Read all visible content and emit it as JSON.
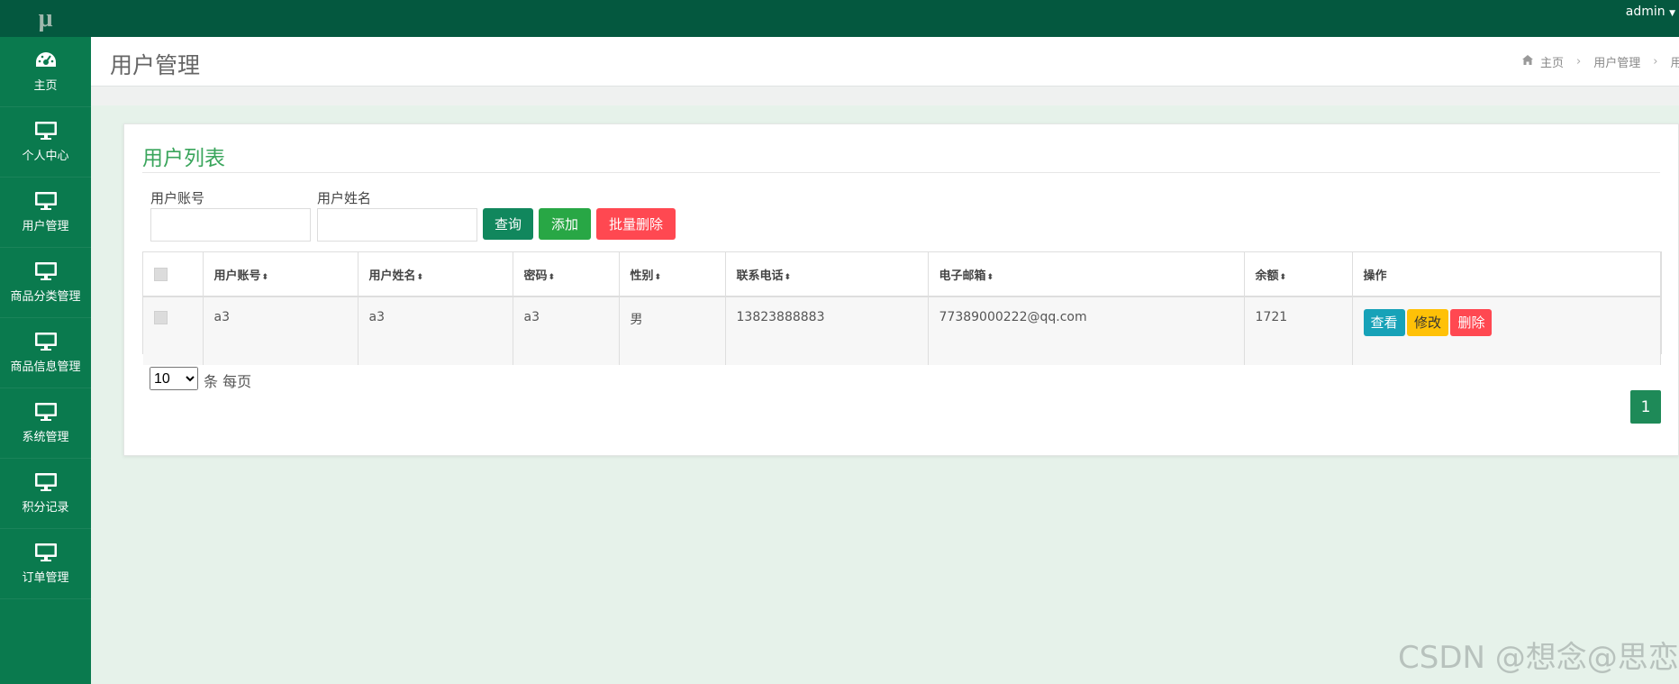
{
  "colors": {
    "sidebar": "#0a7a4e",
    "topbar": "#04583f",
    "accent_green": "#3aa55c",
    "btn_query": "#11875d",
    "btn_add": "#28a745",
    "btn_batch_delete": "#ff4851",
    "btn_view": "#17a2b8",
    "btn_edit": "#ffc107",
    "btn_delete": "#ff4851"
  },
  "logo": "μ",
  "sidebar": {
    "items": [
      {
        "label": "主页",
        "icon": "dashboard-icon"
      },
      {
        "label": "个人中心",
        "icon": "monitor-icon"
      },
      {
        "label": "用户管理",
        "icon": "monitor-icon"
      },
      {
        "label": "商品分类管理",
        "icon": "monitor-icon"
      },
      {
        "label": "商品信息管理",
        "icon": "monitor-icon"
      },
      {
        "label": "系统管理",
        "icon": "monitor-icon"
      },
      {
        "label": "积分记录",
        "icon": "monitor-icon"
      },
      {
        "label": "订单管理",
        "icon": "monitor-icon"
      }
    ]
  },
  "topbar": {
    "user": "admin"
  },
  "header": {
    "title": "用户管理",
    "breadcrumb": [
      "主页",
      "用户管理",
      "用"
    ]
  },
  "card": {
    "title": "用户列表",
    "search": {
      "account_label": "用户账号",
      "name_label": "用户姓名",
      "account_value": "",
      "name_value": ""
    },
    "buttons": {
      "query": "查询",
      "add": "添加",
      "batch_delete": "批量删除"
    }
  },
  "table": {
    "columns": [
      "用户账号",
      "用户姓名",
      "密码",
      "性别",
      "联系电话",
      "电子邮箱",
      "余额",
      "操作"
    ],
    "rows": [
      {
        "account": "a3",
        "name": "a3",
        "password": "a3",
        "gender": "男",
        "phone": "13823888883",
        "email": "77389000222@qq.com",
        "balance": "1721",
        "actions": [
          "查看",
          "修改",
          "删除"
        ]
      }
    ]
  },
  "pager": {
    "page_size": "10",
    "page_size_suffix": "条 每页",
    "current_page": "1"
  },
  "watermark": "CSDN @想念@思恋"
}
